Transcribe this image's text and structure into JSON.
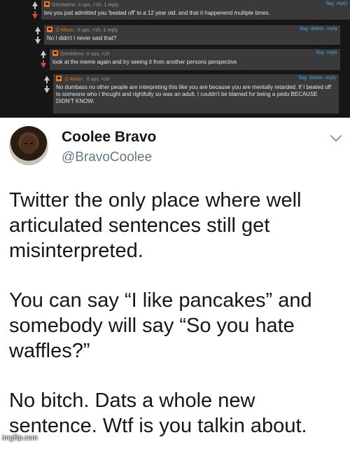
{
  "thread": {
    "comments": [
      {
        "user": "GrimNemo",
        "meta": "0 ups, <1h, 1 reply",
        "actions": [
          "flag",
          "reply"
        ],
        "text": "bro you just admitted you 'beated off' to a 12 year old. and that it happenend multiple times."
      },
      {
        "user": ".C-Moon.",
        "meta": "0 ups, <1h, 1 reply",
        "actions": [
          "flag",
          "delete",
          "reply"
        ],
        "text": "No I didn't I never said that?"
      },
      {
        "user": "GrimNemo",
        "meta": "0 ups, <1h",
        "actions": [
          "flag",
          "reply"
        ],
        "text": "look at the meme again and try seeing it from another persons perspective"
      },
      {
        "user": ".C-Moon.",
        "meta": "0 ups, <1h",
        "actions": [
          "flag",
          "delete",
          "reply"
        ],
        "text": "No dumbass no other people are interpreting this like you are because you are mentally retarded. If I beated off to someone who I thought and rightfully so was an adult, I couldn't be blamed for being a pedo BECAUSE DIDN'T KNOW."
      }
    ]
  },
  "tweet": {
    "name": "Coolee Bravo",
    "handle": "@BravoCoolee",
    "paragraphs": [
      "Twitter the only place where well articulated sentences still get misinterpreted.",
      "You can say “I like pancakes” and somebody will say “So you hate waffles?”",
      "No bitch. Dats a whole new sentence. Wtf is you talkin about."
    ]
  },
  "watermark": "imgflip.com",
  "colors": {
    "thread_bg": "#161616",
    "comment_bg": "#3a3a3a",
    "link_blue": "#3fa2e6",
    "username_orange": "#e8791c",
    "downvote_red": "#e0433a"
  }
}
